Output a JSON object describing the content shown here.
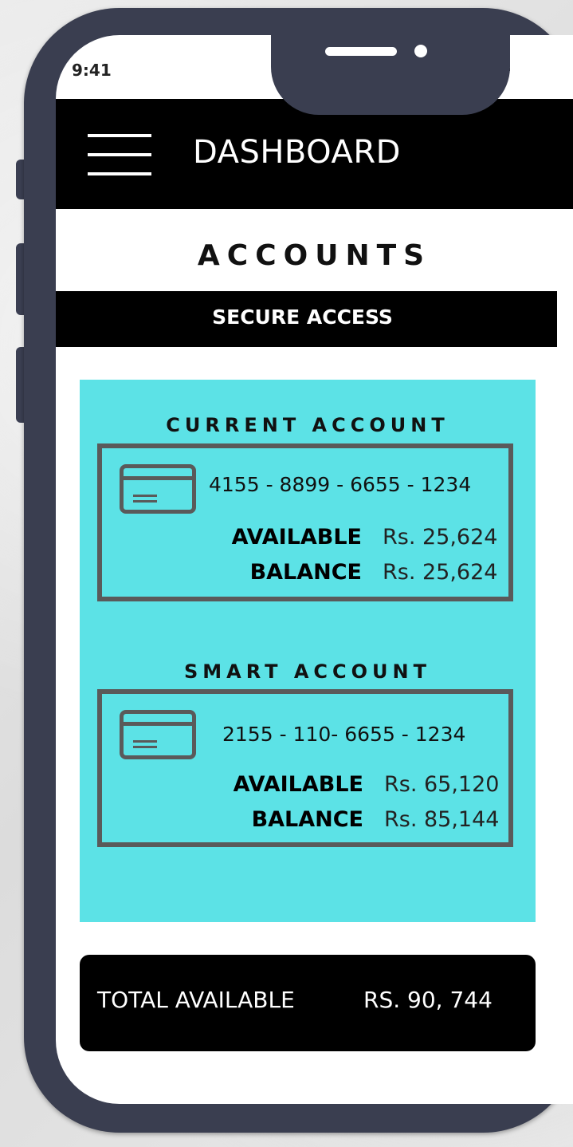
{
  "status_bar": {
    "time": "9:41"
  },
  "header": {
    "title": "DASHBOARD"
  },
  "page": {
    "title": "ACCOUNTS",
    "banner": "SECURE ACCESS"
  },
  "accounts": [
    {
      "heading": "CURRENT ACCOUNT",
      "card_number": "4155 - 8899 - 6655 - 1234",
      "available_label": "AVAILABLE",
      "available_amount": "Rs. 25,624",
      "balance_label": "BALANCE",
      "balance_amount": "Rs. 25,624"
    },
    {
      "heading": "SMART ACCOUNT",
      "card_number": "2155 - 110- 6655 - 1234",
      "available_label": "AVAILABLE",
      "available_amount": "Rs. 65,120",
      "balance_label": "BALANCE",
      "balance_amount": "Rs. 85,144"
    }
  ],
  "total": {
    "label": "TOTAL AVAILABLE",
    "value": "RS. 90, 744"
  },
  "colors": {
    "accent_panel": "#5ce2e6",
    "frame": "#3a3e50",
    "bar": "#000000"
  },
  "icons": [
    "menu-icon",
    "credit-card-icon",
    "signal-icon",
    "wifi-icon",
    "battery-icon"
  ]
}
